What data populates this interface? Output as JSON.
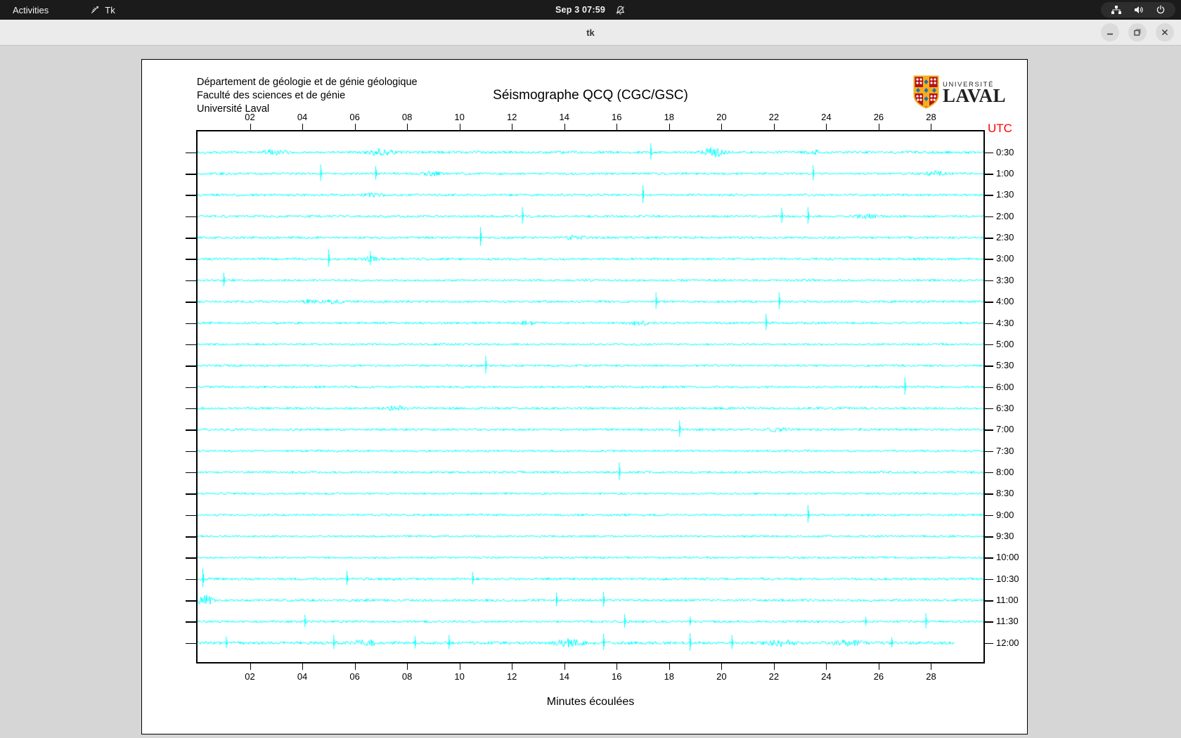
{
  "topbar": {
    "activities_label": "Activities",
    "app_label": "Tk",
    "clock": "Sep 3 07:59",
    "icons": [
      "tk-feather-icon",
      "notifications-disabled-icon",
      "network-wired-icon",
      "volume-icon",
      "power-icon"
    ]
  },
  "titlebar": {
    "title": "tk",
    "controls": [
      "minimize",
      "maximize",
      "close"
    ]
  },
  "header": {
    "dept_lines": "Département de géologie et de génie géologique\nFaculté des sciences et de génie\nUniversité Laval",
    "title": "Séismographe QCQ (CGC/GSC)"
  },
  "logo": {
    "line1": "UNIVERSITÉ",
    "line2": "LAVAL",
    "shield_red": "#b5121b",
    "shield_gold": "#f2b01e",
    "shield_blue": "#1e6fb8"
  },
  "chart_data": {
    "type": "line",
    "subtype": "helicorder-seismograph",
    "title": "Séismographe QCQ (CGC/GSC)",
    "xlabel": "Minutes écoulées",
    "utc_label": "UTC",
    "x_range": [
      0,
      30
    ],
    "x_ticks": [
      "02",
      "04",
      "06",
      "08",
      "10",
      "12",
      "14",
      "16",
      "18",
      "20",
      "22",
      "24",
      "26",
      "28"
    ],
    "trace_color": "#00ffff",
    "utc_color": "#ff0000",
    "grid": false,
    "rows": [
      {
        "label": "0:30",
        "base_amp": 1.8,
        "end_min": 30,
        "events": [
          [
            2.9,
            5,
            0.5
          ],
          [
            7.0,
            7,
            0.45
          ],
          [
            17.3,
            13,
            0.05
          ],
          [
            19.7,
            10,
            0.4
          ],
          [
            23.6,
            4,
            0.3
          ]
        ]
      },
      {
        "label": "1:00",
        "base_amp": 1.6,
        "end_min": 30,
        "events": [
          [
            4.7,
            13,
            0.05
          ],
          [
            6.8,
            11,
            0.05
          ],
          [
            8.9,
            4,
            0.4
          ],
          [
            23.5,
            12,
            0.05
          ],
          [
            28.2,
            5,
            0.35
          ]
        ]
      },
      {
        "label": "1:30",
        "base_amp": 1.6,
        "end_min": 30,
        "events": [
          [
            6.7,
            4,
            0.4
          ],
          [
            17.0,
            14,
            0.05
          ]
        ]
      },
      {
        "label": "2:00",
        "base_amp": 1.6,
        "end_min": 30,
        "events": [
          [
            12.4,
            13,
            0.05
          ],
          [
            22.3,
            12,
            0.05
          ],
          [
            23.3,
            13,
            0.05
          ],
          [
            25.5,
            4,
            0.4
          ]
        ]
      },
      {
        "label": "2:30",
        "base_amp": 1.6,
        "end_min": 30,
        "events": [
          [
            10.8,
            15,
            0.05
          ],
          [
            14.4,
            5,
            0.3
          ]
        ]
      },
      {
        "label": "3:00",
        "base_amp": 1.6,
        "end_min": 30,
        "events": [
          [
            5.0,
            14,
            0.05
          ],
          [
            6.6,
            11,
            0.06
          ],
          [
            6.6,
            5,
            0.25
          ]
        ]
      },
      {
        "label": "3:30",
        "base_amp": 1.5,
        "end_min": 30,
        "events": [
          [
            1.0,
            11,
            0.05
          ]
        ]
      },
      {
        "label": "4:00",
        "base_amp": 1.6,
        "end_min": 30,
        "events": [
          [
            4.2,
            4,
            0.3
          ],
          [
            5.2,
            4,
            0.3
          ],
          [
            17.5,
            13,
            0.05
          ],
          [
            22.2,
            13,
            0.05
          ]
        ]
      },
      {
        "label": "4:30",
        "base_amp": 1.6,
        "end_min": 30,
        "events": [
          [
            12.6,
            4,
            0.3
          ],
          [
            16.9,
            5,
            0.3
          ],
          [
            21.7,
            13,
            0.05
          ]
        ]
      },
      {
        "label": "5:00",
        "base_amp": 1.4,
        "end_min": 30,
        "events": []
      },
      {
        "label": "5:30",
        "base_amp": 1.5,
        "end_min": 30,
        "events": [
          [
            11.0,
            14,
            0.05
          ]
        ]
      },
      {
        "label": "6:00",
        "base_amp": 1.5,
        "end_min": 30,
        "events": [
          [
            27.0,
            14,
            0.05
          ]
        ]
      },
      {
        "label": "6:30",
        "base_amp": 1.6,
        "end_min": 30,
        "events": [
          [
            7.6,
            6,
            0.35
          ]
        ]
      },
      {
        "label": "7:00",
        "base_amp": 1.6,
        "end_min": 30,
        "events": [
          [
            18.4,
            13,
            0.05
          ],
          [
            22.2,
            4,
            0.4
          ]
        ]
      },
      {
        "label": "7:30",
        "base_amp": 1.4,
        "end_min": 30,
        "events": []
      },
      {
        "label": "8:00",
        "base_amp": 1.6,
        "end_min": 30,
        "events": [
          [
            16.1,
            14,
            0.05
          ]
        ]
      },
      {
        "label": "8:30",
        "base_amp": 1.4,
        "end_min": 30,
        "events": []
      },
      {
        "label": "9:00",
        "base_amp": 1.5,
        "end_min": 30,
        "events": [
          [
            23.3,
            14,
            0.05
          ]
        ]
      },
      {
        "label": "9:30",
        "base_amp": 1.4,
        "end_min": 30,
        "events": []
      },
      {
        "label": "10:00",
        "base_amp": 1.4,
        "end_min": 30,
        "events": []
      },
      {
        "label": "10:30",
        "base_amp": 1.7,
        "end_min": 30,
        "events": [
          [
            0.2,
            15,
            0.05
          ],
          [
            5.7,
            11,
            0.05
          ],
          [
            10.5,
            10,
            0.05
          ]
        ]
      },
      {
        "label": "11:00",
        "base_amp": 1.7,
        "end_min": 30,
        "events": [
          [
            0.3,
            11,
            0.3
          ],
          [
            13.7,
            11,
            0.05
          ],
          [
            15.5,
            12,
            0.05
          ]
        ]
      },
      {
        "label": "11:30",
        "base_amp": 1.6,
        "end_min": 30,
        "events": [
          [
            4.1,
            10,
            0.05
          ],
          [
            16.3,
            11,
            0.05
          ],
          [
            18.8,
            7,
            0.05
          ],
          [
            25.5,
            7,
            0.05
          ],
          [
            27.8,
            12,
            0.05
          ]
        ]
      },
      {
        "label": "12:00",
        "base_amp": 2.1,
        "end_min": 28.9,
        "events": [
          [
            1.1,
            9,
            0.05
          ],
          [
            5.2,
            11,
            0.05
          ],
          [
            6.4,
            7,
            0.4
          ],
          [
            8.3,
            10,
            0.05
          ],
          [
            9.6,
            11,
            0.05
          ],
          [
            14.2,
            8,
            0.45
          ],
          [
            15.5,
            13,
            0.05
          ],
          [
            18.8,
            14,
            0.05
          ],
          [
            20.4,
            11,
            0.05
          ],
          [
            22.3,
            7,
            0.45
          ],
          [
            24.9,
            7,
            0.45
          ],
          [
            26.5,
            8,
            0.05
          ]
        ]
      }
    ]
  }
}
